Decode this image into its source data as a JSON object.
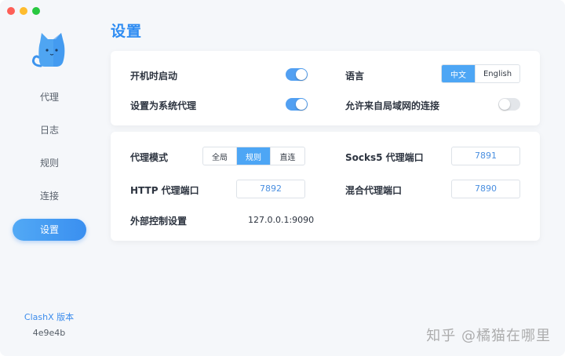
{
  "sidebar": {
    "items": [
      {
        "label": "代理"
      },
      {
        "label": "日志"
      },
      {
        "label": "规则"
      },
      {
        "label": "连接"
      },
      {
        "label": "设置"
      }
    ],
    "active_index": 4,
    "version_label": "ClashX 版本",
    "version_value": "4e9e4b"
  },
  "page": {
    "title": "设置"
  },
  "general": {
    "launch_at_login": {
      "label": "开机时启动",
      "enabled": true
    },
    "system_proxy": {
      "label": "设置为系统代理",
      "enabled": true
    },
    "language": {
      "label": "语言",
      "options": [
        "中文",
        "English"
      ],
      "selected": "中文"
    },
    "allow_lan": {
      "label": "允许来自局域网的连接",
      "enabled": false
    }
  },
  "proxy": {
    "mode": {
      "label": "代理模式",
      "options": [
        "全局",
        "规则",
        "直连"
      ],
      "selected": "规则"
    },
    "socks5_port": {
      "label": "Socks5 代理端口",
      "value": "7891"
    },
    "http_port": {
      "label": "HTTP 代理端口",
      "value": "7892"
    },
    "mixed_port": {
      "label": "混合代理端口",
      "value": "7890"
    },
    "external_controller": {
      "label": "外部控制设置",
      "value": "127.0.0.1:9090"
    }
  },
  "colors": {
    "accent": "#3c8cec",
    "toggle_on": "#52a0f2",
    "toggle_off": "#e3e6ea",
    "background": "#f5f7fa"
  },
  "watermark": "知乎 @橘猫在哪里"
}
